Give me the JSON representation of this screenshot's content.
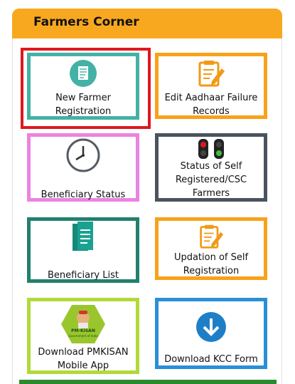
{
  "panel": {
    "title": "Farmers Corner"
  },
  "tiles": [
    {
      "label": "New Farmer\nRegistration",
      "border_color": "#44b1a6",
      "icon": "form-icon"
    },
    {
      "label": "Edit Aadhaar Failure\nRecords",
      "border_color": "#f8a21a",
      "icon": "edit-document-icon"
    },
    {
      "label": "Beneficiary Status",
      "border_color": "#ea83e2",
      "icon": "clock-icon"
    },
    {
      "label": "Status of Self\nRegistered/CSC\nFarmers",
      "border_color": "#4a5360",
      "icon": "traffic-light-icon"
    },
    {
      "label": "Beneficiary List",
      "border_color": "#22806d",
      "icon": "list-document-icon"
    },
    {
      "label": "Updation of Self\nRegistration",
      "border_color": "#f8a21a",
      "icon": "edit-document-icon"
    },
    {
      "label": "Download PMKISAN\nMobile App",
      "border_color": "#b2d93a",
      "icon": "pmkisan-logo-icon",
      "logo_text": "PM-KISAN",
      "logo_subtext": "Government of India"
    },
    {
      "label": "Download KCC Form",
      "border_color": "#2a8fd6",
      "icon": "download-icon"
    }
  ],
  "colors": {
    "header": "#f8a81f",
    "highlight": "#e0171f",
    "bottom_bar": "#2c8a2e"
  }
}
